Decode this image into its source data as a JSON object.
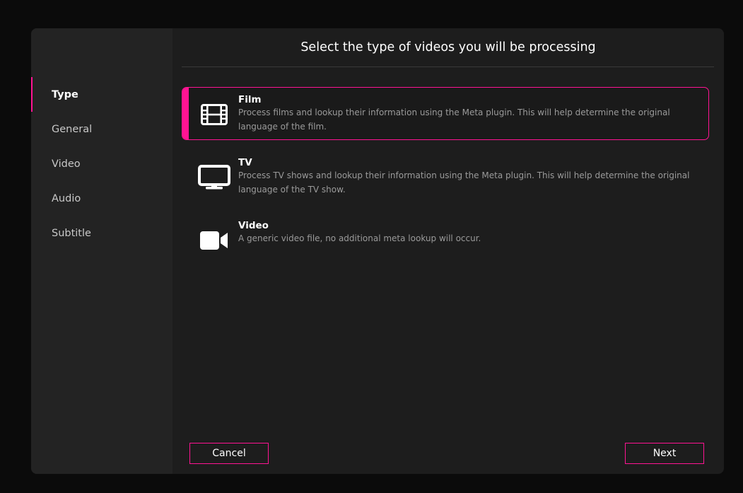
{
  "sidebar": {
    "items": [
      {
        "label": "Type",
        "active": true
      },
      {
        "label": "General",
        "active": false
      },
      {
        "label": "Video",
        "active": false
      },
      {
        "label": "Audio",
        "active": false
      },
      {
        "label": "Subtitle",
        "active": false
      }
    ]
  },
  "main": {
    "title": "Select the type of videos you will be processing",
    "options": [
      {
        "label": "Film",
        "icon": "film-icon",
        "description": "Process films and lookup their information using the Meta plugin. This will help determine the original language of the film.",
        "selected": true
      },
      {
        "label": "TV",
        "icon": "tv-icon",
        "description": "Process TV shows and lookup their information using the Meta plugin. This will help determine the original language of the TV show.",
        "selected": false
      },
      {
        "label": "Video",
        "icon": "video-camera-icon",
        "description": "A generic video file, no additional meta lookup will occur.",
        "selected": false
      }
    ]
  },
  "footer": {
    "cancel_label": "Cancel",
    "next_label": "Next"
  },
  "colors": {
    "accent": "#ff1493",
    "background": "#0b0b0b",
    "dialog": "#1d1d1d",
    "sidebar": "#232323"
  }
}
